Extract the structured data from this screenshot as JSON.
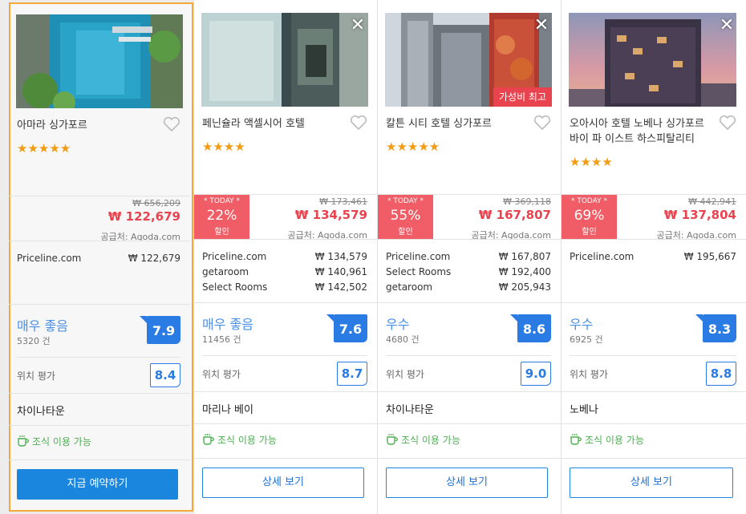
{
  "hotels": [
    {
      "name": "아마라 싱가포르",
      "stars": "★★★★★",
      "original_price": "₩ 656,209",
      "price": "₩ 122,679",
      "supplier": "공급처: Agoda.com",
      "providers": [
        {
          "name": "Priceline.com",
          "price": "₩ 122,679"
        }
      ],
      "rating_label": "매우 좋음",
      "review_count": "5320 건",
      "score": "7.9",
      "location_label": "위치 평가",
      "location_score": "8.4",
      "area": "차이나타운",
      "breakfast": "조식 이용 가능",
      "button": "지금 예약하기"
    },
    {
      "name": "페닌슐라 액셀시어 호텔",
      "stars": "★★★★",
      "today": {
        "label": "* TODAY *",
        "percent": "22%",
        "word": "할인"
      },
      "original_price": "₩ 173,461",
      "price": "₩ 134,579",
      "supplier": "공급처: Agoda.com",
      "providers": [
        {
          "name": "Priceline.com",
          "price": "₩ 134,579"
        },
        {
          "name": "getaroom",
          "price": "₩ 140,961"
        },
        {
          "name": "Select Rooms",
          "price": "₩ 142,502"
        }
      ],
      "rating_label": "매우 좋음",
      "review_count": "11456 건",
      "score": "7.6",
      "location_label": "위치 평가",
      "location_score": "8.7",
      "area": "마리나 베이",
      "breakfast": "조식 이용 가능",
      "button": "상세 보기"
    },
    {
      "name": "칼튼 시티 호텔 싱가포르",
      "stars": "★★★★★",
      "value_badge": "가성비 최고",
      "today": {
        "label": "* TODAY *",
        "percent": "55%",
        "word": "할인"
      },
      "original_price": "₩ 369,118",
      "price": "₩ 167,807",
      "supplier": "공급처: Agoda.com",
      "providers": [
        {
          "name": "Priceline.com",
          "price": "₩ 167,807"
        },
        {
          "name": "Select Rooms",
          "price": "₩ 192,400"
        },
        {
          "name": "getaroom",
          "price": "₩ 205,943"
        }
      ],
      "rating_label": "우수",
      "review_count": "4680 건",
      "score": "8.6",
      "location_label": "위치 평가",
      "location_score": "9.0",
      "area": "차이나타운",
      "breakfast": "조식 이용 가능",
      "button": "상세 보기"
    },
    {
      "name": "오아시아 호텔 노베나 싱가포르 바이 파 이스트 하스피탈리티",
      "stars": "★★★★",
      "today": {
        "label": "* TODAY *",
        "percent": "69%",
        "word": "할인"
      },
      "original_price": "₩ 442,941",
      "price": "₩ 137,804",
      "supplier": "공급처: Agoda.com",
      "providers": [
        {
          "name": "Priceline.com",
          "price": "₩ 195,667"
        }
      ],
      "rating_label": "우수",
      "review_count": "6925 건",
      "score": "8.3",
      "location_label": "위치 평가",
      "location_score": "8.8",
      "area": "노베나",
      "breakfast": "조식 이용 가능",
      "button": "상세 보기"
    }
  ],
  "colors": {
    "accent_blue": "#1b86de",
    "price_red": "#e8434e",
    "star_orange": "#f39c12",
    "breakfast_green": "#4caf50",
    "highlight_border": "#f4a93a"
  }
}
